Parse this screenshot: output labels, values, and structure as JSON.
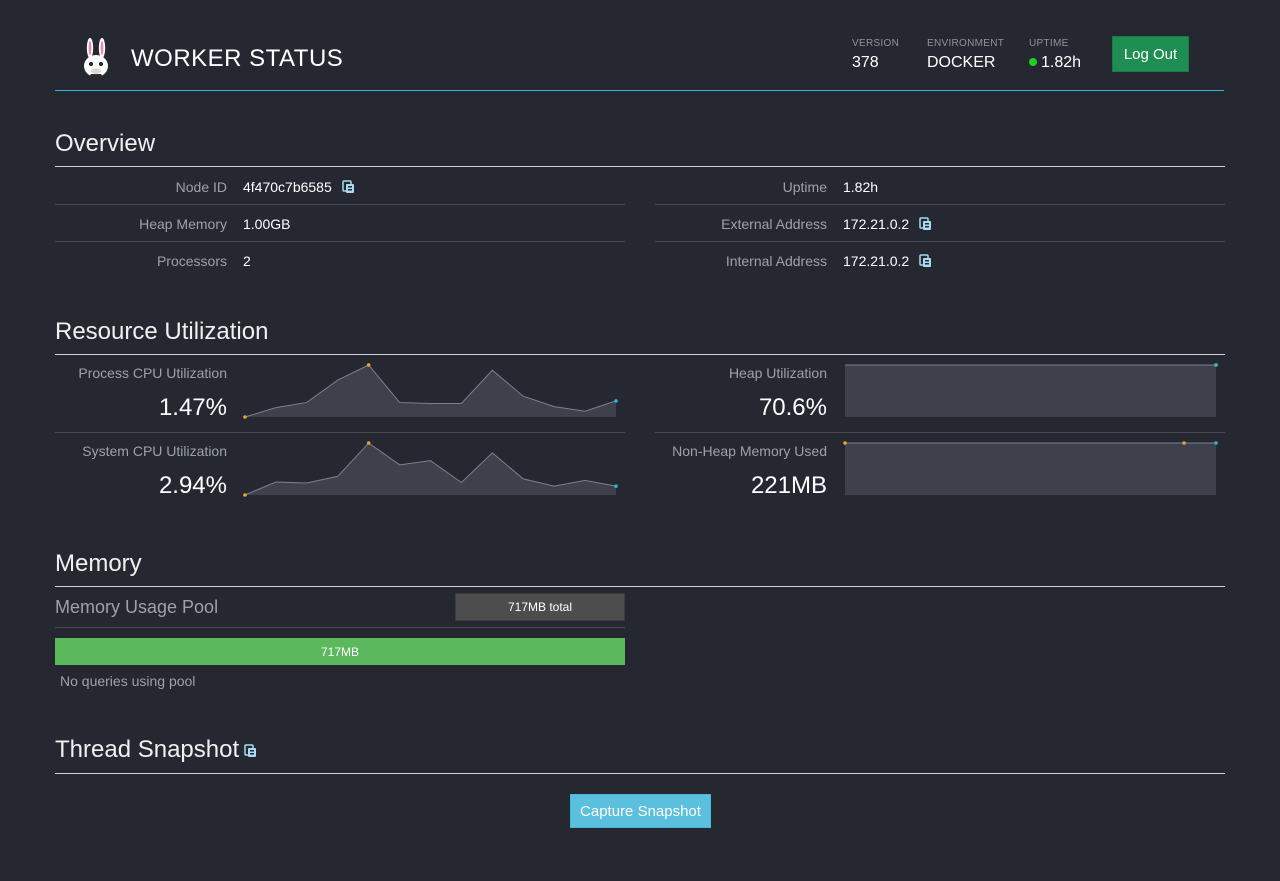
{
  "header": {
    "title": "WORKER STATUS",
    "version_label": "VERSION",
    "version": "378",
    "environment_label": "ENVIRONMENT",
    "environment": "DOCKER",
    "uptime_label": "UPTIME",
    "uptime": "1.82h",
    "logout_label": "Log Out"
  },
  "overview": {
    "title": "Overview",
    "left": [
      {
        "label": "Node ID",
        "value": "4f470c7b6585",
        "copy": true
      },
      {
        "label": "Heap Memory",
        "value": "1.00GB",
        "copy": false
      },
      {
        "label": "Processors",
        "value": "2",
        "copy": false
      }
    ],
    "right": [
      {
        "label": "Uptime",
        "value": "1.82h",
        "copy": false
      },
      {
        "label": "External Address",
        "value": "172.21.0.2",
        "copy": true
      },
      {
        "label": "Internal Address",
        "value": "172.21.0.2",
        "copy": true
      }
    ]
  },
  "resources": {
    "title": "Resource Utilization",
    "metrics": [
      {
        "label": "Process CPU Utilization",
        "value": "1.47%",
        "series": [
          0,
          0.18,
          0.28,
          0.71,
          1.0,
          0.28,
          0.26,
          0.26,
          0.9,
          0.4,
          0.2,
          0.11,
          0.31
        ],
        "min_index": 0,
        "max_index": 4
      },
      {
        "label": "Heap Utilization",
        "value": "70.6%",
        "series": [
          1.0,
          1.0
        ],
        "min_index": null,
        "max_index": 1
      },
      {
        "label": "System CPU Utilization",
        "value": "2.94%",
        "series": [
          0,
          0.25,
          0.23,
          0.36,
          1.0,
          0.58,
          0.66,
          0.24,
          0.81,
          0.31,
          0.17,
          0.28,
          0.17
        ],
        "min_index": 0,
        "max_index": 4
      },
      {
        "label": "Non-Heap Memory Used",
        "value": "221MB",
        "series": [
          1.0,
          1.0,
          1.0
        ],
        "min_index": 0,
        "max_index": 1,
        "points_at": [
          0,
          0.914,
          1.0
        ]
      }
    ]
  },
  "memory": {
    "title": "Memory",
    "pool_label": "Memory Usage Pool",
    "pool_total": "717MB total",
    "pool_bar": "717MB",
    "pool_fill_fraction": 1.0,
    "no_queries": "No queries using pool"
  },
  "thread": {
    "title": "Thread Snapshot",
    "capture_label": "Capture Snapshot"
  },
  "colors": {
    "background": "#252831",
    "accent_rule": "#2fb3d6",
    "logout": "#1e8e52",
    "pool_bar": "#5cb85c",
    "capture_button": "#5bc0de",
    "spark_min_dot": "#f0a030",
    "spark_last_dot": "#2fb3d6",
    "copy_icon": "#a8dcef"
  }
}
